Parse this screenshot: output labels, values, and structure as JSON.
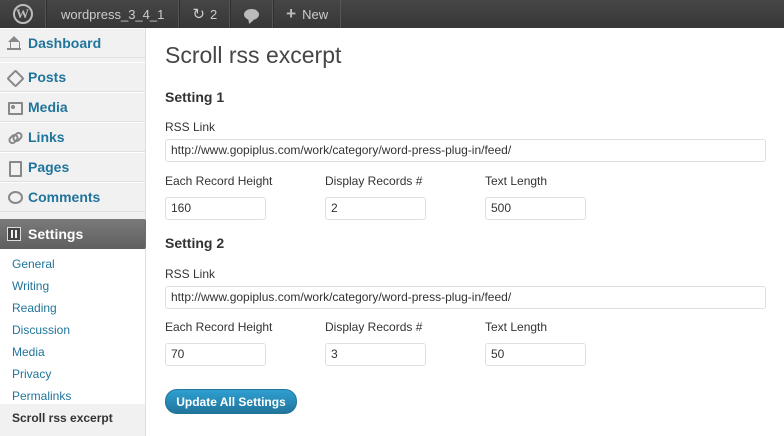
{
  "adminbar": {
    "site_name": "wordpress_3_4_1",
    "updates_count": "2",
    "new_label": "New"
  },
  "sidebar": {
    "items": [
      {
        "label": "Dashboard",
        "icon": "dashboard-icon"
      },
      {
        "label": "Posts",
        "icon": "posts-icon"
      },
      {
        "label": "Media",
        "icon": "media-icon"
      },
      {
        "label": "Links",
        "icon": "links-icon"
      },
      {
        "label": "Pages",
        "icon": "pages-icon"
      },
      {
        "label": "Comments",
        "icon": "comments-icon"
      },
      {
        "label": "Settings",
        "icon": "settings-icon"
      }
    ],
    "submenu": [
      "General",
      "Writing",
      "Reading",
      "Discussion",
      "Media",
      "Privacy",
      "Permalinks",
      "Scroll rss excerpt"
    ]
  },
  "main": {
    "title": "Scroll rss excerpt",
    "settings": [
      {
        "heading": "Setting 1",
        "rss_label": "RSS Link",
        "rss_value": "http://www.gopiplus.com/work/category/word-press-plug-in/feed/",
        "height_label": "Each Record Height",
        "height_value": "160",
        "records_label": "Display Records #",
        "records_value": "2",
        "length_label": "Text Length",
        "length_value": "500"
      },
      {
        "heading": "Setting 2",
        "rss_label": "RSS Link",
        "rss_value": "http://www.gopiplus.com/work/category/word-press-plug-in/feed/",
        "height_label": "Each Record Height",
        "height_value": "70",
        "records_label": "Display Records #",
        "records_value": "3",
        "length_label": "Text Length",
        "length_value": "50"
      }
    ],
    "submit_label": "Update All Settings"
  },
  "colors": {
    "link": "#21759b",
    "adminbar": "#464646",
    "button": "#21759b"
  }
}
